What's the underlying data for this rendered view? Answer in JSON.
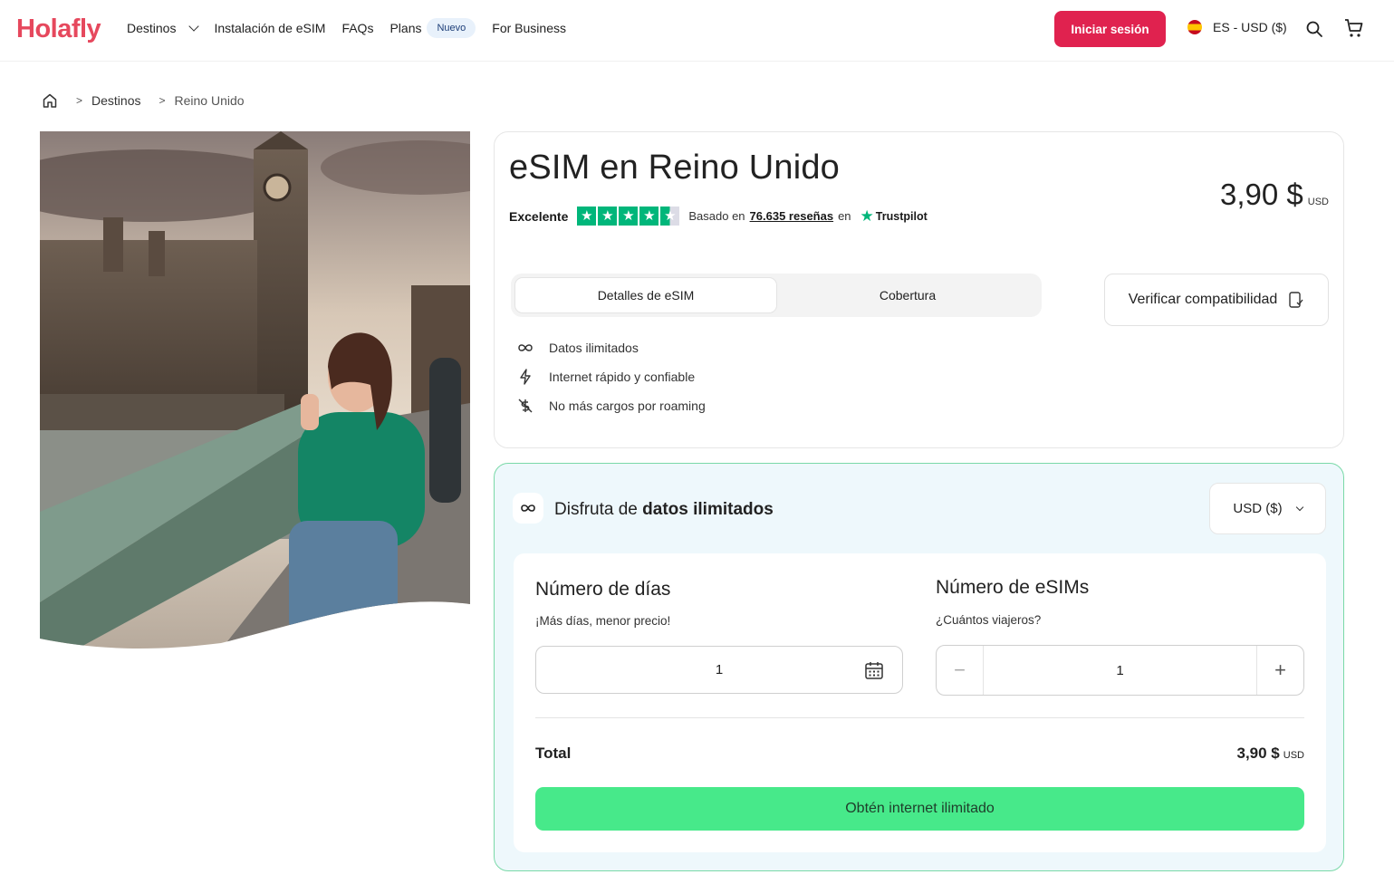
{
  "brand": {
    "logo": "Holafly",
    "accent": "#e0224f",
    "green": "#47e98a"
  },
  "nav": {
    "destinos": "Destinos",
    "instalacion": "Instalación de eSIM",
    "faqs": "FAQs",
    "plans": "Plans",
    "plans_badge": "Nuevo",
    "business": "For Business"
  },
  "header": {
    "login": "Iniciar sesión",
    "locale": "ES - USD ($)"
  },
  "breadcrumb": {
    "sep": ">",
    "destinos": "Destinos",
    "current": "Reino Unido"
  },
  "product": {
    "title": "eSIM en Reino Unido",
    "price": "3,90 $",
    "price_unit": "USD",
    "rating": {
      "word": "Excelente",
      "stars": 4.5,
      "based_on": "Basado en",
      "reviews": "76.635 reseñas",
      "on": "en",
      "provider": "Trustpilot"
    },
    "tabs": [
      {
        "label": "Detalles de eSIM",
        "active": true
      },
      {
        "label": "Cobertura",
        "active": false
      }
    ],
    "verify": "Verificar compatibilidad",
    "features": [
      {
        "icon": "infinity-icon",
        "label": "Datos ilimitados"
      },
      {
        "icon": "lightning-icon",
        "label": "Internet rápido y confiable"
      },
      {
        "icon": "no-roaming-icon",
        "label": "No más cargos por roaming"
      }
    ]
  },
  "plan": {
    "title_pre": "Disfruta de",
    "title_bold": "datos ilimitados",
    "currency": "USD ($)",
    "days": {
      "title": "Número de días",
      "subtitle": "¡Más días, menor precio!",
      "value": "1"
    },
    "esims": {
      "title": "Número de eSIMs",
      "subtitle": "¿Cuántos viajeros?",
      "value": "1",
      "minus": "−",
      "plus": "+"
    },
    "total_label": "Total",
    "total_price": "3,90 $",
    "total_unit": "USD",
    "cta": "Obtén internet ilimitado"
  }
}
